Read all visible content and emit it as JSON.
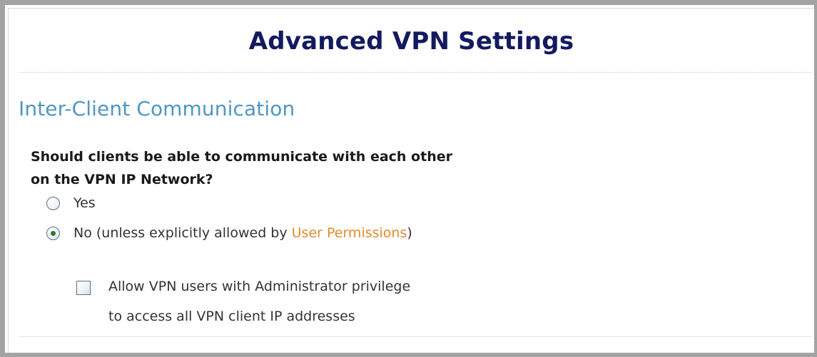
{
  "page": {
    "title": "Advanced VPN Settings"
  },
  "section": {
    "heading": "Inter-Client Communication",
    "question_line1": "Should clients be able to communicate with each other",
    "question_line2": "on the VPN IP Network?",
    "options": [
      {
        "label": "Yes",
        "selected": false
      },
      {
        "label_prefix": "No (unless explicitly allowed by ",
        "link_text": "User Permissions",
        "label_suffix": ")",
        "selected": true
      }
    ],
    "admin_checkbox": {
      "checked": false,
      "label_line1": "Allow VPN users with Administrator privilege",
      "label_line2": "to access all VPN client IP addresses"
    }
  },
  "colors": {
    "title": "#131a5e",
    "section_heading": "#4f97c4",
    "link": "#e58a2e",
    "selected_radio_dot": "#2c7a2c"
  }
}
